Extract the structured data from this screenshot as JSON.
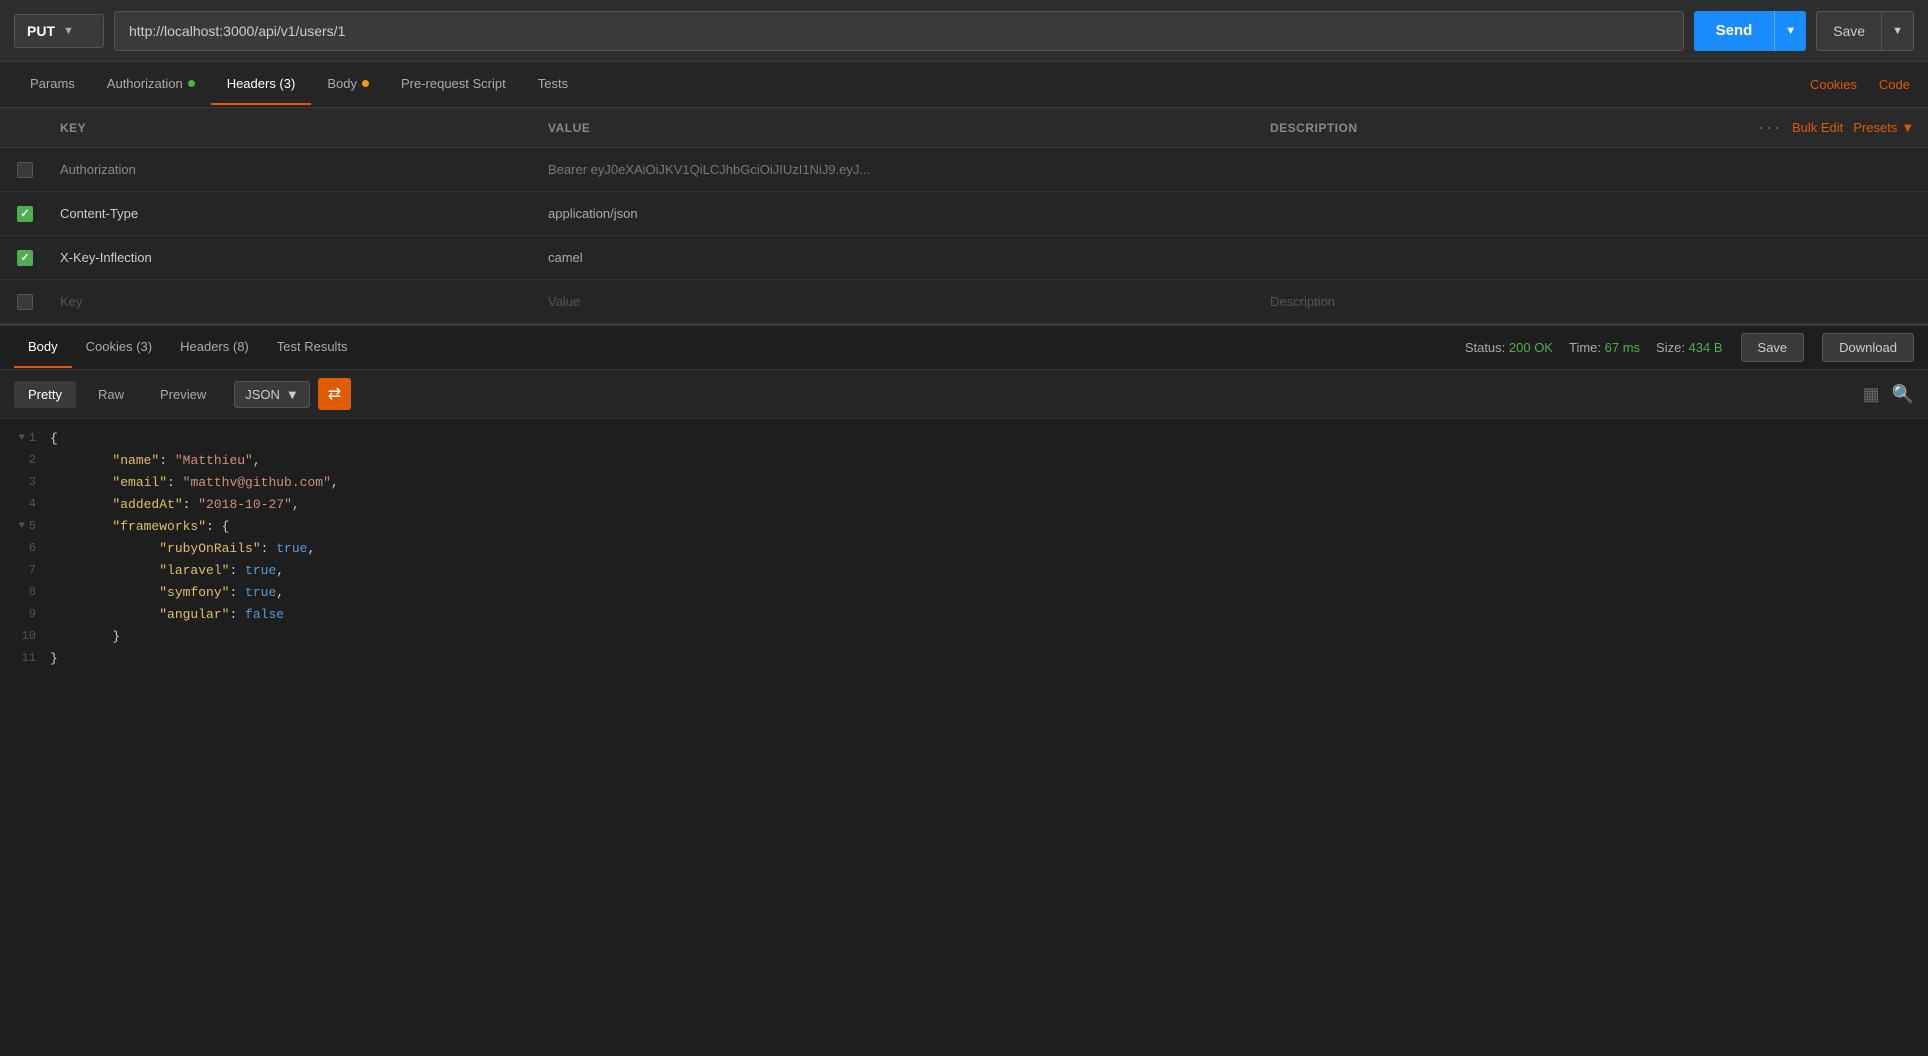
{
  "topbar": {
    "method": "PUT",
    "url": "http://localhost:3000/api/v1/users/1",
    "send_label": "Send",
    "save_label": "Save"
  },
  "request_tabs": {
    "tabs": [
      {
        "id": "params",
        "label": "Params",
        "active": false,
        "dot": null
      },
      {
        "id": "authorization",
        "label": "Authorization",
        "active": false,
        "dot": "green"
      },
      {
        "id": "headers",
        "label": "Headers (3)",
        "active": true,
        "dot": null
      },
      {
        "id": "body",
        "label": "Body",
        "active": false,
        "dot": "orange"
      },
      {
        "id": "pre-request",
        "label": "Pre-request Script",
        "active": false,
        "dot": null
      },
      {
        "id": "tests",
        "label": "Tests",
        "active": false,
        "dot": null
      }
    ],
    "right_links": [
      "Cookies",
      "Code"
    ]
  },
  "headers_table": {
    "columns": [
      "KEY",
      "VALUE",
      "DESCRIPTION"
    ],
    "bulk_edit_label": "Bulk Edit",
    "presets_label": "Presets",
    "rows": [
      {
        "checked": false,
        "key": "Authorization",
        "value": "Bearer eyJ0eXAiOiJKV1QiLCJhbGciOiJIUzI1NiJ9.eyJ...",
        "description": "",
        "placeholder": false
      },
      {
        "checked": true,
        "key": "Content-Type",
        "value": "application/json",
        "description": "",
        "placeholder": false
      },
      {
        "checked": true,
        "key": "X-Key-Inflection",
        "value": "camel",
        "description": "",
        "placeholder": false
      },
      {
        "checked": false,
        "key": "Key",
        "value": "Value",
        "description": "Description",
        "placeholder": true
      }
    ]
  },
  "response_tabs": {
    "tabs": [
      {
        "id": "body",
        "label": "Body",
        "active": true
      },
      {
        "id": "cookies",
        "label": "Cookies (3)",
        "active": false
      },
      {
        "id": "headers",
        "label": "Headers (8)",
        "active": false
      },
      {
        "id": "test-results",
        "label": "Test Results",
        "active": false
      }
    ],
    "status": {
      "label": "Status:",
      "value": "200 OK",
      "time_label": "Time:",
      "time_value": "67 ms",
      "size_label": "Size:",
      "size_value": "434 B"
    },
    "save_label": "Save",
    "download_label": "Download"
  },
  "format_bar": {
    "tabs": [
      {
        "id": "pretty",
        "label": "Pretty",
        "active": true
      },
      {
        "id": "raw",
        "label": "Raw",
        "active": false
      },
      {
        "id": "preview",
        "label": "Preview",
        "active": false
      }
    ],
    "format_select": "JSON"
  },
  "code_viewer": {
    "lines": [
      {
        "num": 1,
        "collapsible": true,
        "content": "{"
      },
      {
        "num": 2,
        "collapsible": false,
        "content": "  \"name\": \"Matthieu\","
      },
      {
        "num": 3,
        "collapsible": false,
        "content": "  \"email\": \"matthv@github.com\","
      },
      {
        "num": 4,
        "collapsible": false,
        "content": "  \"addedAt\": \"2018-10-27\","
      },
      {
        "num": 5,
        "collapsible": true,
        "content": "  \"frameworks\": {"
      },
      {
        "num": 6,
        "collapsible": false,
        "content": "    \"rubyOnRails\": true,"
      },
      {
        "num": 7,
        "collapsible": false,
        "content": "    \"laravel\": true,"
      },
      {
        "num": 8,
        "collapsible": false,
        "content": "    \"symfony\": true,"
      },
      {
        "num": 9,
        "collapsible": false,
        "content": "    \"angular\": false"
      },
      {
        "num": 10,
        "collapsible": false,
        "content": "  }"
      },
      {
        "num": 11,
        "collapsible": false,
        "content": "}"
      }
    ]
  }
}
